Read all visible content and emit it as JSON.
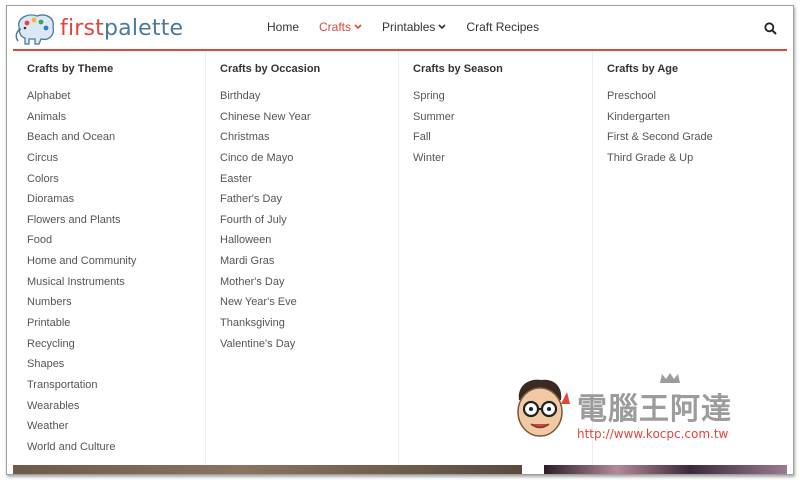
{
  "header": {
    "logo": {
      "first": "first",
      "palette": "palette"
    },
    "nav": [
      {
        "label": "Home"
      },
      {
        "label": "Crafts"
      },
      {
        "label": "Printables"
      },
      {
        "label": "Craft Recipes"
      }
    ]
  },
  "mega_menu": {
    "columns": [
      {
        "title": "Crafts by Theme",
        "items": [
          "Alphabet",
          "Animals",
          "Beach and Ocean",
          "Circus",
          "Colors",
          "Dioramas",
          "Flowers and Plants",
          "Food",
          "Home and Community",
          "Musical Instruments",
          "Numbers",
          "Printable",
          "Recycling",
          "Shapes",
          "Transportation",
          "Wearables",
          "Weather",
          "World and Culture"
        ]
      },
      {
        "title": "Crafts by Occasion",
        "items": [
          "Birthday",
          "Chinese New Year",
          "Christmas",
          "Cinco de Mayo",
          "Easter",
          "Father's Day",
          "Fourth of July",
          "Halloween",
          "Mardi Gras",
          "Mother's Day",
          "New Year's Eve",
          "Thanksgiving",
          "Valentine's Day"
        ]
      },
      {
        "title": "Crafts by Season",
        "items": [
          "Spring",
          "Summer",
          "Fall",
          "Winter"
        ]
      },
      {
        "title": "Crafts by Age",
        "items": [
          "Preschool",
          "Kindergarten",
          "First & Second Grade",
          "Third Grade & Up"
        ]
      }
    ]
  },
  "watermark": {
    "title": "電腦王阿達",
    "url": "http://www.kocpc.com.tw"
  },
  "colors": {
    "accent": "#e0463c",
    "logo_blue": "#4a7a9a",
    "text": "#555555"
  }
}
